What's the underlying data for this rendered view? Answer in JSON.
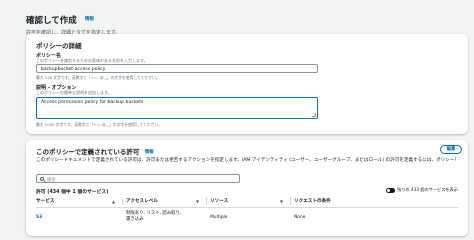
{
  "page": {
    "title": "確認して作成",
    "info_label": "情報",
    "subtitle": "許可を確認し、詳細とタグを指定します。"
  },
  "policy_details": {
    "heading": "ポリシーの詳細",
    "name_label": "ポリシー名",
    "name_desc": "このポリシーを識別するための意味のある名前を入力します。",
    "name_value": "backupbucket-access-policy",
    "name_constraint": "最大 128 文字です。英数字と「+=,.@-_」の文字を使用してください。",
    "description_label": "説明 - オプション",
    "description_desc": "このポリシーの簡単な説明を追加します。",
    "description_value": "Access permission policy for backup buckets",
    "description_constraint": "最大 1000 文字です。英数字と「+=,.@-_」の文字を使用してください。"
  },
  "permissions": {
    "heading": "このポリシーで定義されている許可",
    "info_label": "情報",
    "edit_button": "編集",
    "description": "このポリシードキュメントで定義されている許可は、許可または拒否するアクションを指定します。IAM アイデンティティ (ユーザー、ユーザーグループ、またはロール) の許可を定義するには、ポリシーをアタッチします。",
    "search_placeholder": "検索",
    "count_label": "許可 (434 個中 1 個のサービス)",
    "toggle_label": "残りの 433 個のサービスを表示",
    "columns": [
      "サービス",
      "アクセスレベル",
      "リソース",
      "リクエストの条件"
    ],
    "rows": [
      {
        "service": "S3",
        "access": "制限あり: リスト, 読み取り, 書き込み",
        "resource": "Multiple",
        "condition": "None"
      }
    ]
  }
}
